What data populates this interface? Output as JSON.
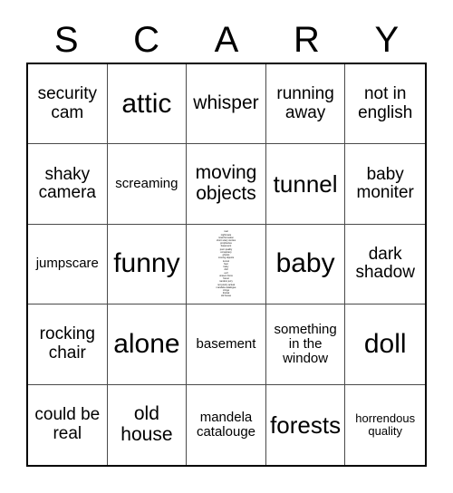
{
  "card": {
    "title_letters": [
      "S",
      "C",
      "A",
      "R",
      "Y"
    ],
    "colors": {
      "background": "#ffffff",
      "text": "#000000",
      "outer_border": "#000000",
      "grid_line": "#4a4a4a"
    },
    "columns": 5,
    "rows": 5,
    "cells": [
      {
        "text": "security cam",
        "size": "m"
      },
      {
        "text": "attic",
        "size": "xxl"
      },
      {
        "text": "whisper",
        "size": "l"
      },
      {
        "text": "running away",
        "size": "m"
      },
      {
        "text": "not in english",
        "size": "m"
      },
      {
        "text": "shaky camera",
        "size": "m"
      },
      {
        "text": "screaming",
        "size": "s"
      },
      {
        "text": "moving objects",
        "size": "l"
      },
      {
        "text": "tunnel",
        "size": "xl"
      },
      {
        "text": "baby moniter",
        "size": "m"
      },
      {
        "text": "jumpscare",
        "size": "s"
      },
      {
        "text": "funny",
        "size": "xxl"
      },
      {
        "text": "real\nnightmare\nmisinformation\nshort scary stories\nprophecies\nbasement\npoor quality\nconspiracy\nghosts\nmoving objects\ntunnel\nfear\nbaby\ndoll\nevil\nunseen force\nforest\nrandom jerry\nnot poorly actual\nmandela catalogue\ncringe\nliminal\nold house",
        "size": "free"
      },
      {
        "text": "baby",
        "size": "xxl"
      },
      {
        "text": "dark shadow",
        "size": "m"
      },
      {
        "text": "rocking chair",
        "size": "m"
      },
      {
        "text": "alone",
        "size": "xxl"
      },
      {
        "text": "basement",
        "size": "s"
      },
      {
        "text": "something in the window",
        "size": "s"
      },
      {
        "text": "doll",
        "size": "xxl"
      },
      {
        "text": "could be real",
        "size": "m"
      },
      {
        "text": "old house",
        "size": "l"
      },
      {
        "text": "mandela catalouge",
        "size": "s"
      },
      {
        "text": "forests",
        "size": "xl"
      },
      {
        "text": "horrendous quality",
        "size": "xs"
      }
    ]
  }
}
